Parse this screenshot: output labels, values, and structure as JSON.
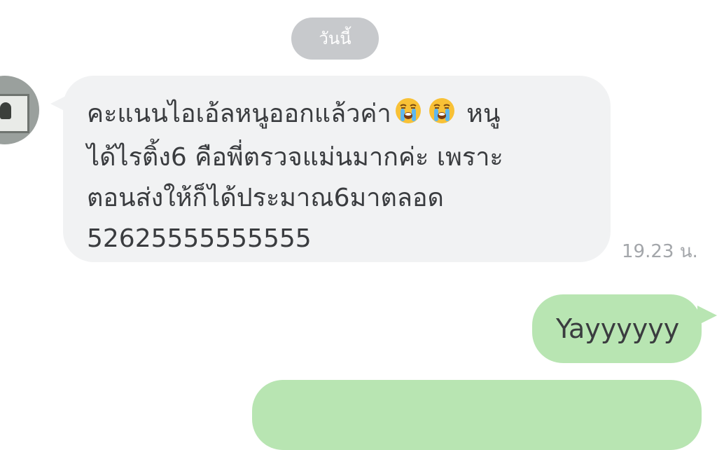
{
  "chat": {
    "date_label": "วันนี้",
    "incoming": {
      "lines": [
        "คะแนนไอเอ้ลหนูออกแล้วค่า",
        "หนู",
        "ได้ไรติ้ง6 คือพี่ตรวจแม่นมากค่ะ เพราะ",
        "ตอนส่งให้ก็ได้ประมาณ6มาตลอด",
        "52625555555555"
      ],
      "emoji": [
        "loudly-crying-face-icon",
        "loudly-crying-face-icon"
      ],
      "time": "19.23 น."
    },
    "outgoing": [
      {
        "text": "Yayyyyyy"
      },
      {
        "text": ""
      }
    ]
  },
  "colors": {
    "incoming_bubble": "#f1f2f3",
    "outgoing_bubble": "#b8e5b2",
    "date_pill": "#c7c9cc",
    "text": "#3a3c3f",
    "timestamp": "#a3a6aa"
  }
}
